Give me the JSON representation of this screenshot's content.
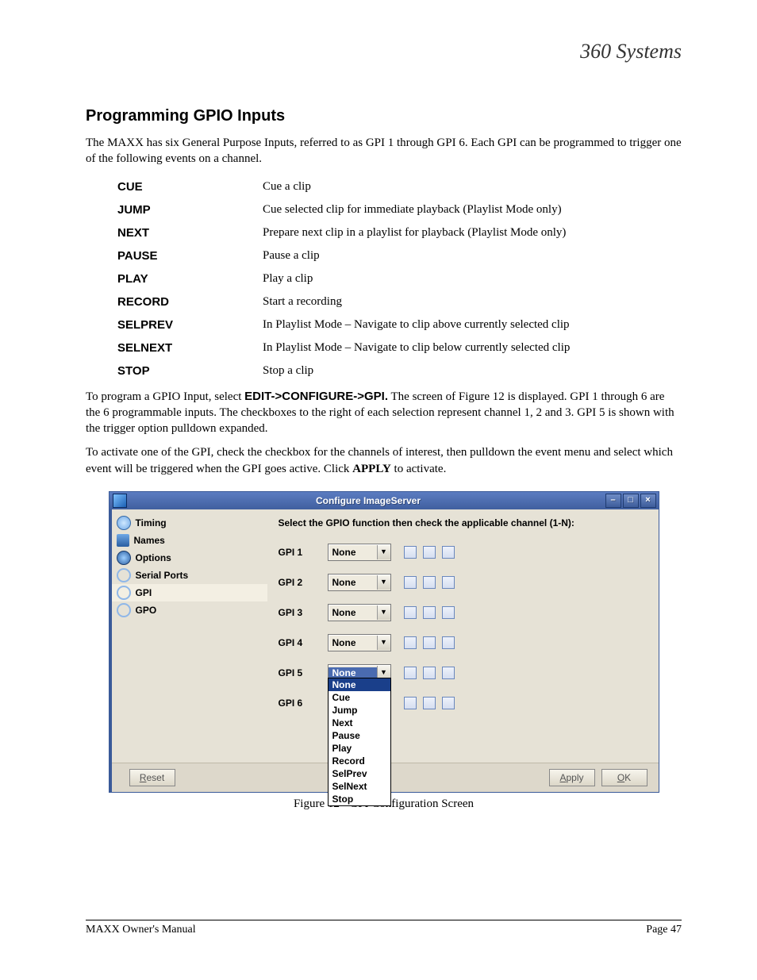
{
  "logo_text": "360 Systems",
  "heading": "Programming GPIO Inputs",
  "intro": "The MAXX has six General Purpose Inputs, referred to as GPI 1 through GPI 6.  Each GPI can be programmed to trigger one of the following events on a channel.",
  "commands": [
    {
      "k": "CUE",
      "d": "Cue a clip"
    },
    {
      "k": "JUMP",
      "d": "Cue selected clip for immediate playback   (Playlist Mode only)"
    },
    {
      "k": "NEXT",
      "d": "Prepare next clip in a playlist for playback (Playlist Mode only)"
    },
    {
      "k": "PAUSE",
      "d": "Pause a clip"
    },
    {
      "k": "PLAY",
      "d": "Play a clip"
    },
    {
      "k": "RECORD",
      "d": "Start a recording"
    },
    {
      "k": "SELPREV",
      "d": "In Playlist Mode – Navigate to clip above currently selected clip"
    },
    {
      "k": "SELNEXT",
      "d": "In Playlist Mode – Navigate to clip below currently selected clip"
    },
    {
      "k": "STOP",
      "d": "Stop a clip"
    }
  ],
  "para2_a": "To program a GPIO Input, select ",
  "para2_b": "EDIT->CONFIGURE->GPI.",
  "para2_c": " The screen of Figure 12 is displayed. GPI 1 through 6 are the 6 programmable inputs. The checkboxes to the right of each selection represent channel 1, 2 and 3. GPI 5 is shown with the trigger option pulldown expanded.",
  "para3_a": "To activate one of the GPI, check the checkbox for the channels of interest, then pulldown the event menu and select which event will be triggered when the GPI goes active. Click ",
  "para3_b": "APPLY",
  "para3_c": " to activate.",
  "dialog": {
    "title": "Configure ImageServer",
    "nav": [
      "Timing",
      "Names",
      "Options",
      "Serial Ports",
      "GPI",
      "GPO"
    ],
    "nav_selected_index": 4,
    "instruction": "Select the GPIO function then check the applicable channel (1-N):",
    "rows": [
      {
        "label": "GPI 1",
        "value": "None",
        "open": false
      },
      {
        "label": "GPI 2",
        "value": "None",
        "open": false
      },
      {
        "label": "GPI 3",
        "value": "None",
        "open": false
      },
      {
        "label": "GPI 4",
        "value": "None",
        "open": false
      },
      {
        "label": "GPI 5",
        "value": "None",
        "open": true
      },
      {
        "label": "GPI 6",
        "value": "",
        "open": false
      }
    ],
    "options": [
      "None",
      "Cue",
      "Jump",
      "Next",
      "Pause",
      "Play",
      "Record",
      "SelPrev",
      "SelNext",
      "Stop"
    ],
    "buttons": {
      "reset_u": "R",
      "reset": "eset",
      "apply_u": "A",
      "apply": "pply",
      "ok_u": "O",
      "ok": "K"
    }
  },
  "caption": "Figure 12 - GPI Configuration Screen",
  "footer": {
    "left": "MAXX Owner's Manual",
    "right": "Page 47"
  }
}
